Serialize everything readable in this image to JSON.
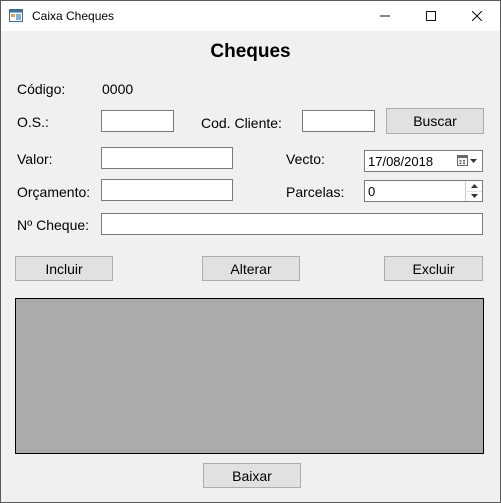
{
  "window": {
    "title": "Caixa Cheques"
  },
  "form": {
    "heading": "Cheques",
    "codigo_label": "Código:",
    "codigo_value": "0000",
    "os_label": "O.S.:",
    "os_value": "",
    "cod_cliente_label": "Cod. Cliente:",
    "cod_cliente_value": "",
    "buscar_label": "Buscar",
    "valor_label": "Valor:",
    "valor_value": "",
    "vecto_label": "Vecto:",
    "vecto_value": "17/08/2018",
    "orcamento_label": "Orçamento:",
    "orcamento_value": "",
    "parcelas_label": "Parcelas:",
    "parcelas_value": "0",
    "cheque_label": "Nº Cheque:",
    "cheque_value": ""
  },
  "actions": {
    "incluir": "Incluir",
    "alterar": "Alterar",
    "excluir": "Excluir",
    "baixar": "Baixar"
  },
  "colors": {
    "grid_bg": "#ababab",
    "form_bg": "#f0f0f0",
    "button_bg": "#e1e1e1"
  }
}
